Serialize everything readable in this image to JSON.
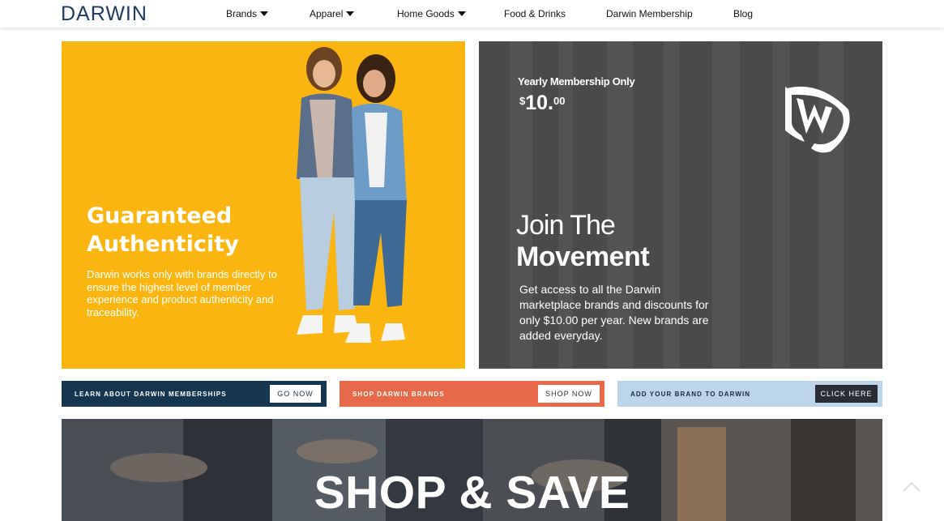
{
  "header": {
    "logo": "DARWIN",
    "nav": [
      {
        "label": "Brands",
        "dropdown": true
      },
      {
        "label": "Apparel",
        "dropdown": true
      },
      {
        "label": "Home Goods",
        "dropdown": true
      },
      {
        "label": "Food & Drinks",
        "dropdown": false
      },
      {
        "label": "Darwin Membership",
        "dropdown": false
      },
      {
        "label": "Blog",
        "dropdown": false
      }
    ]
  },
  "hero_left": {
    "title_line1": "Guaranteed",
    "title_line2": "Authenticity",
    "description": "Darwin works only with brands directly to ensure the highest level of member experience and product authenticity and traceability.",
    "background": "#fbb511"
  },
  "hero_right": {
    "yearly": "Yearly Membership Only",
    "price_symbol": "$",
    "price_main": "10.",
    "price_cents": "00",
    "join_line1": "Join The",
    "join_line2": "Movement",
    "description": "Get access to all the Darwin marketplace brands and discounts for only $10.00 per year. New brands are added everyday.",
    "background": "#4a4a4c"
  },
  "cta_bars": [
    {
      "label": "LEARN ABOUT DARWIN MEMBERSHIPS",
      "button": "GO NOW",
      "bg": "#16354f"
    },
    {
      "label": "SHOP DARWIN BRANDS",
      "button": "SHOP NOW",
      "bg": "#e8684a"
    },
    {
      "label": "ADD YOUR BRAND TO DARWIN",
      "button": "CLICK HERE",
      "bg": "#bcd5ea"
    }
  ],
  "banner": {
    "title": "SHOP & SAVE"
  }
}
